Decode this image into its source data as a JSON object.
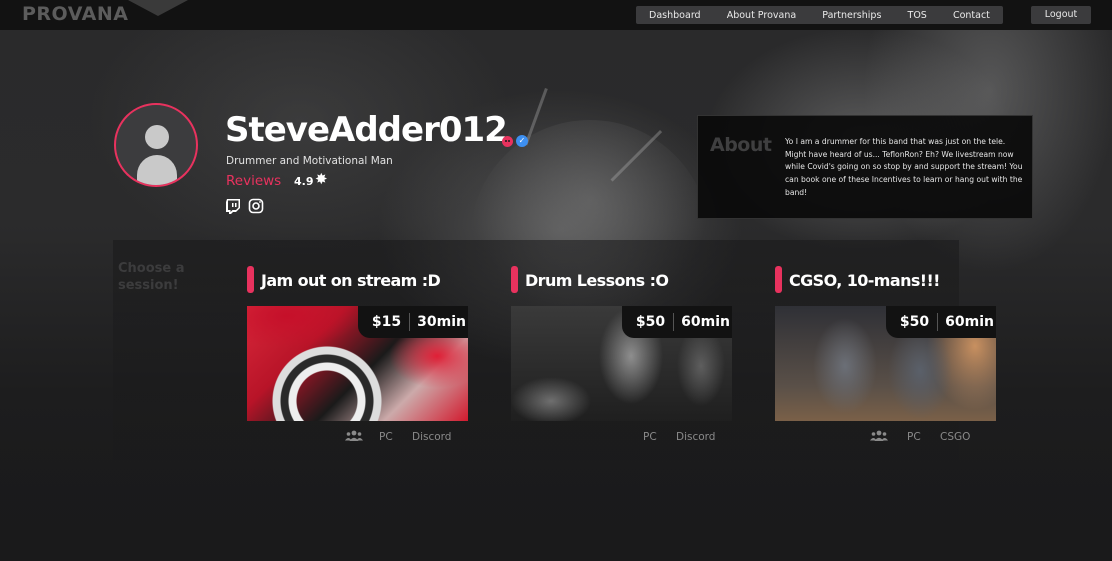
{
  "brand": {
    "logo_text": "PROVANA",
    "accent": "#e8325e"
  },
  "nav": {
    "items": [
      "Dashboard",
      "About Provana",
      "Partnerships",
      "TOS",
      "Contact"
    ],
    "logout": "Logout"
  },
  "profile": {
    "username": "SteveAdder012",
    "tagline": "Drummer and Motivational Man",
    "reviews_label": "Reviews",
    "rating": "4.9",
    "verified_mark": "✓",
    "social_icons": [
      "twitch-icon",
      "instagram-icon"
    ]
  },
  "about": {
    "heading": "About",
    "text": "Yo I am a drummer for this band that was just on the tele. Might have heard of us... TeflonRon? Eh? We livestream now while Covid's going on so stop by and support the stream! You can book one of these Incentives to learn or hang out with the band!"
  },
  "sessions": {
    "heading": "Choose a session!",
    "cards": [
      {
        "title": "Jam out on stream :D",
        "price": "$15",
        "duration": "30min",
        "platform": "PC",
        "app": "Discord",
        "group": true
      },
      {
        "title": "Drum Lessons :O",
        "price": "$50",
        "duration": "60min",
        "platform": "PC",
        "app": "Discord",
        "group": false
      },
      {
        "title": "CGSO, 10-mans!!!",
        "price": "$50",
        "duration": "60min",
        "platform": "PC",
        "app": "CSGO",
        "group": true
      }
    ]
  }
}
